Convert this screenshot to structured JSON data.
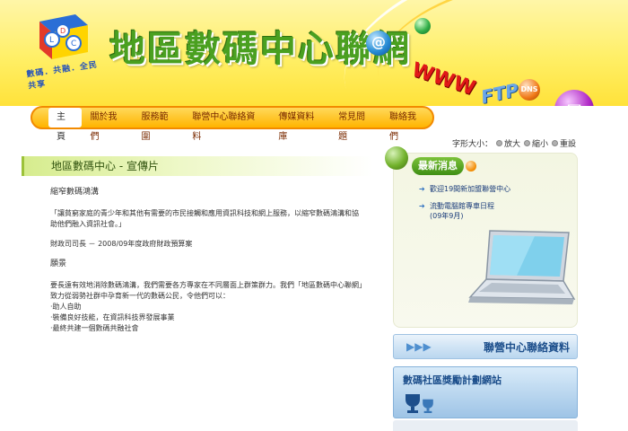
{
  "header": {
    "site_title": "地區數碼中心聯網",
    "logo_letters": [
      "L",
      "D",
      "C"
    ],
    "logo_tagline": "數碼．共融．全民共享",
    "deco": {
      "www": "WWW",
      "ftp": "FTP",
      "dns": "DNS",
      "at": "@",
      "mail": "✉"
    }
  },
  "nav": {
    "items": [
      "主頁",
      "關於我們",
      "服務範圍",
      "聯營中心聯絡資料",
      "傳媒資料庫",
      "常見問題",
      "聯絡我們"
    ],
    "active": "主頁"
  },
  "fontbar": {
    "label": "字形大小：",
    "enlarge": "放大",
    "shrink": "縮小",
    "reset": "重設"
  },
  "page": {
    "title": "地區數碼中心 - 宣傳片",
    "subtitle": "縮窄數碼鴻溝",
    "para1": "「讓貧窮家庭的青少年和其他有需要的市民接觸和應用資訊科技和網上服務，以縮窄數碼鴻溝和協助他們融入資訊社會。」",
    "para2": "財政司司長 － 2008/09年度政府財政預算案",
    "vision_heading": "願景",
    "para3": "要長遠有效地消除數碼鴻溝，我們需要各方專家在不同層面上群策群力。我們「地區數碼中心聯網」致力從弱勢社群中孕育新一代的數碼公民，令他們可以：",
    "bullets": [
      "‧助人自助",
      "‧裝備良好技能，在資訊科技界發展事業",
      "‧最終共建一個數碼共融社會"
    ]
  },
  "news": {
    "heading": "最新消息",
    "items": [
      "歡迎19間新加盟聯營中心",
      "流動電腦館專車日程\n(09年9月)"
    ]
  },
  "banners": {
    "contact": "聯營中心聯絡資料",
    "award": "數碼社區獎勵計劃網站"
  },
  "colors": {
    "accent_green": "#4aa020",
    "nav_orange": "#ffb400",
    "link_blue": "#1a3c7a"
  }
}
